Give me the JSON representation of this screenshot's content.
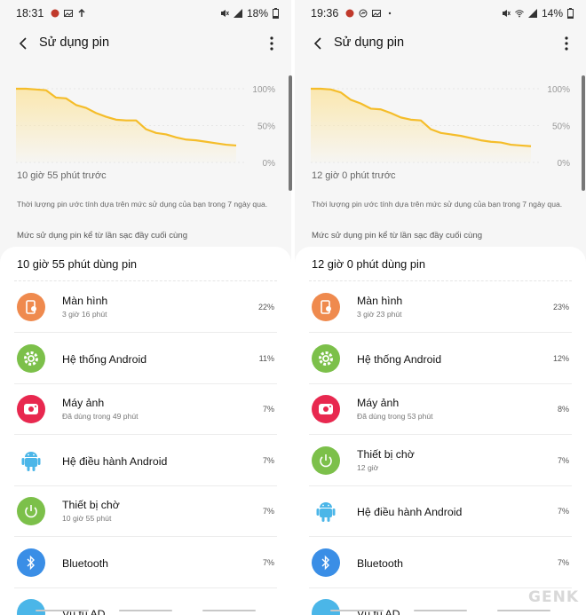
{
  "left": {
    "status": {
      "time": "18:31",
      "battery": "18%"
    },
    "header": {
      "title": "Sử dụng pin"
    },
    "chart_data": {
      "type": "line",
      "y_ticks": [
        "100%",
        "50%",
        "0%"
      ],
      "ylim": [
        0,
        100
      ],
      "x": [
        0,
        1,
        2,
        3,
        4,
        5,
        6,
        7,
        8,
        9,
        10,
        11,
        12,
        13,
        14,
        15,
        16,
        17,
        18,
        19,
        20,
        21,
        22
      ],
      "values": [
        100,
        100,
        99,
        98,
        88,
        87,
        78,
        74,
        67,
        62,
        58,
        57,
        57,
        45,
        40,
        38,
        34,
        31,
        30,
        28,
        26,
        24,
        23
      ],
      "colors": {
        "line": "#f5bd2a",
        "fill": "#fbe6a8"
      }
    },
    "since": "10 giờ 55 phút trước",
    "note": "Thời lượng pin ước tính dựa trên mức sử dụng của bạn trong 7 ngày qua.",
    "section": "Mức sử dụng pin kể từ lần sạc đầy cuối cùng",
    "card_title": "10 giờ 55 phút dùng pin",
    "rows": [
      {
        "icon": "screen-icon",
        "color": "#ef8a4e",
        "name": "Màn hình",
        "sub": "3 giờ 16 phút",
        "pct": "22%"
      },
      {
        "icon": "gear-icon",
        "color": "#7cc04a",
        "name": "Hệ thống Android",
        "sub": "",
        "pct": "11%"
      },
      {
        "icon": "camera-icon",
        "color": "#e8284f",
        "name": "Máy ảnh",
        "sub": "Đã dùng trong 49 phút",
        "pct": "7%"
      },
      {
        "icon": "android-icon",
        "color": "#4bb6e8",
        "name": "Hệ điều hành Android",
        "sub": "",
        "pct": "7%"
      },
      {
        "icon": "power-icon",
        "color": "#7cc04a",
        "name": "Thiết bị chờ",
        "sub": "10 giờ 55 phút",
        "pct": "7%"
      },
      {
        "icon": "bluetooth-icon",
        "color": "#3a8ee6",
        "name": "Bluetooth",
        "sub": "",
        "pct": "7%"
      },
      {
        "icon": "partial-icon",
        "color": "#4bb6e8",
        "name": "Vũ tu AD",
        "sub": "",
        "pct": ""
      }
    ]
  },
  "right": {
    "status": {
      "time": "19:36",
      "battery": "14%"
    },
    "header": {
      "title": "Sử dụng pin"
    },
    "chart_data": {
      "type": "line",
      "y_ticks": [
        "100%",
        "50%",
        "0%"
      ],
      "ylim": [
        0,
        100
      ],
      "x": [
        0,
        1,
        2,
        3,
        4,
        5,
        6,
        7,
        8,
        9,
        10,
        11,
        12,
        13,
        14,
        15,
        16,
        17,
        18,
        19,
        20,
        21,
        22
      ],
      "values": [
        100,
        100,
        99,
        95,
        85,
        80,
        73,
        72,
        67,
        61,
        58,
        57,
        45,
        40,
        38,
        36,
        33,
        30,
        28,
        27,
        24,
        23,
        22
      ],
      "colors": {
        "line": "#f5bd2a",
        "fill": "#fbe6a8"
      }
    },
    "since": "12 giờ 0 phút trước",
    "note": "Thời lượng pin ước tính dựa trên mức sử dụng của bạn trong 7 ngày qua.",
    "section": "Mức sử dụng pin kể từ lần sạc đầy cuối cùng",
    "card_title": "12 giờ 0 phút dùng pin",
    "rows": [
      {
        "icon": "screen-icon",
        "color": "#ef8a4e",
        "name": "Màn hình",
        "sub": "3 giờ 23 phút",
        "pct": "23%"
      },
      {
        "icon": "gear-icon",
        "color": "#7cc04a",
        "name": "Hệ thống Android",
        "sub": "",
        "pct": "12%"
      },
      {
        "icon": "camera-icon",
        "color": "#e8284f",
        "name": "Máy ảnh",
        "sub": "Đã dùng trong 53 phút",
        "pct": "8%"
      },
      {
        "icon": "power-icon",
        "color": "#7cc04a",
        "name": "Thiết bị chờ",
        "sub": "12 giờ",
        "pct": "7%"
      },
      {
        "icon": "android-icon",
        "color": "#4bb6e8",
        "name": "Hệ điều hành Android",
        "sub": "",
        "pct": "7%"
      },
      {
        "icon": "bluetooth-icon",
        "color": "#3a8ee6",
        "name": "Bluetooth",
        "sub": "",
        "pct": "7%"
      },
      {
        "icon": "partial-icon",
        "color": "#4bb6e8",
        "name": "Vũ tu AD",
        "sub": "",
        "pct": ""
      }
    ]
  },
  "watermark": "GENK"
}
